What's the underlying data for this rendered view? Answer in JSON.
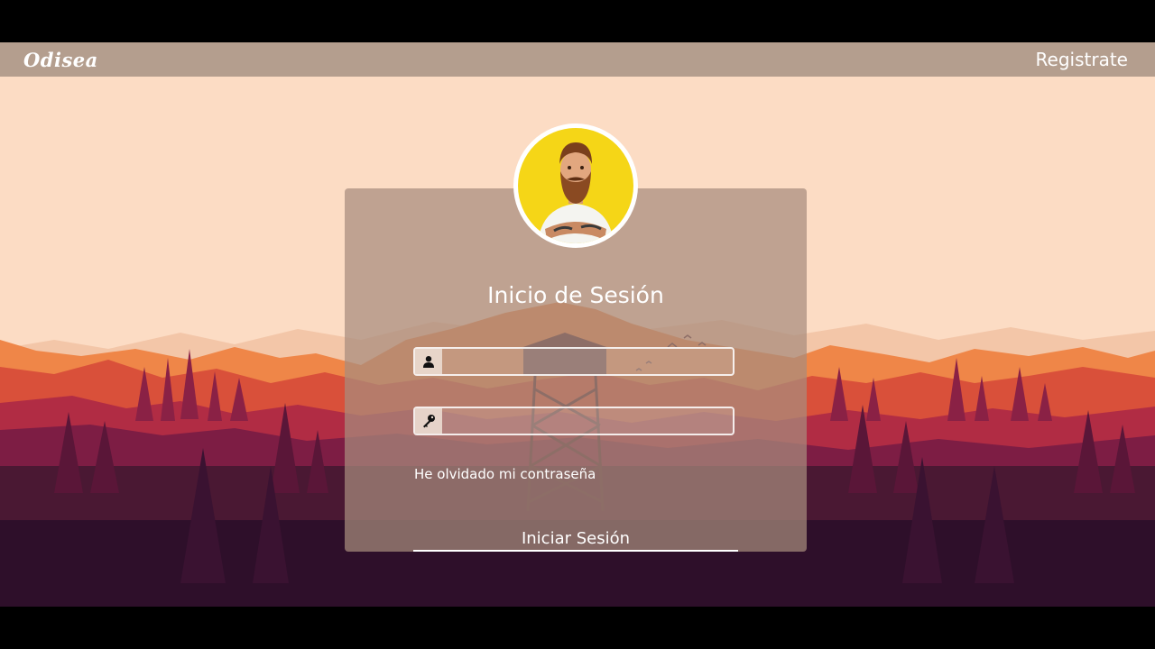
{
  "navbar": {
    "brand": "Odisea",
    "register_label": "Registrate"
  },
  "login": {
    "title": "Inicio de Sesión",
    "username_icon": "user-icon",
    "username_value": "",
    "password_icon": "key-icon",
    "password_value": "",
    "forgot_label": "He olvidado mi contraseña",
    "submit_label": "Iniciar Sesión"
  },
  "colors": {
    "navbar": "#b49e8e",
    "sky": "#fcdcc4",
    "avatar_background": "#f5d617",
    "card": "#a88c7d"
  }
}
